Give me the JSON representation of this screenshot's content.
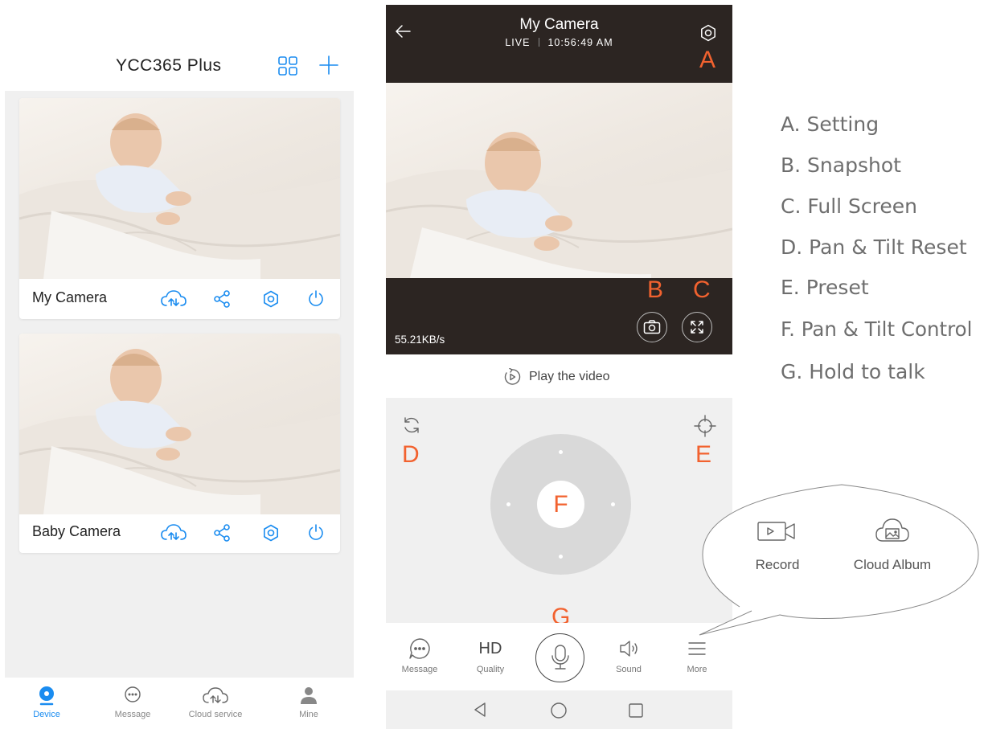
{
  "left": {
    "title": "YCC365 Plus",
    "cards": [
      {
        "name": "My Camera"
      },
      {
        "name": "Baby Camera"
      }
    ],
    "tabs": [
      {
        "label": "Device"
      },
      {
        "label": "Message"
      },
      {
        "label": "Cloud service"
      },
      {
        "label": "Mine"
      }
    ]
  },
  "player": {
    "title": "My Camera",
    "status": "LIVE",
    "time": "10:56:49 AM",
    "bitrate": "55.21KB/s",
    "play_label": "Play the video",
    "bottom": {
      "message": "Message",
      "quality_value": "HD",
      "quality": "Quality",
      "sound": "Sound",
      "more": "More"
    }
  },
  "markers": {
    "a": "A",
    "b": "B",
    "c": "C",
    "d": "D",
    "e": "E",
    "f": "F",
    "g": "G"
  },
  "bubble": {
    "record": "Record",
    "cloud_album": "Cloud Album"
  },
  "legend": [
    "A. Setting",
    "B. Snapshot",
    "C. Full Screen",
    "D. Pan & Tilt Reset",
    "E. Preset",
    "F. Pan & Tilt Control",
    "G. Hold to talk"
  ],
  "colors": {
    "accent": "#1a8cf0",
    "marker": "#f2622f",
    "header": "#2c2522"
  }
}
